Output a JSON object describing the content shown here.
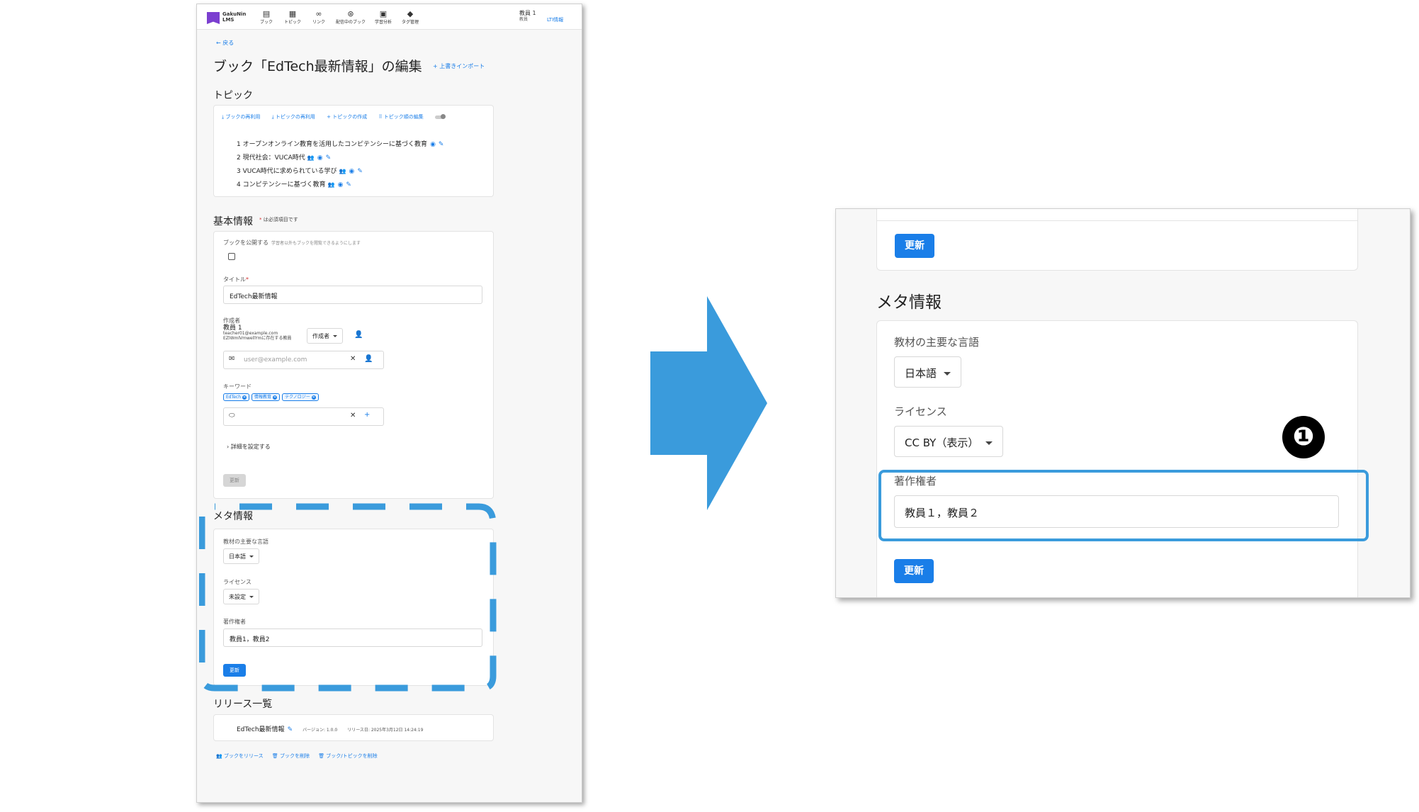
{
  "nav": {
    "logo_line1": "GakuNin",
    "logo_line2": "LMS",
    "items": [
      {
        "icon": "▤",
        "label": "ブック"
      },
      {
        "icon": "▦",
        "label": "トピック"
      },
      {
        "icon": "∞",
        "label": "リンク"
      },
      {
        "icon": "⊛",
        "label": "配信中のブック"
      },
      {
        "icon": "▣",
        "label": "学習分析"
      },
      {
        "icon": "◆",
        "label": "タグ管理"
      }
    ],
    "user_name": "教員 1",
    "user_role": "教員",
    "lti_link": "LTI情報"
  },
  "page": {
    "back_label": "← 戻る",
    "title": "ブック「EdTech最新情報」の編集",
    "import_label": "+ 上書きインポート"
  },
  "topics": {
    "heading": "トピック",
    "toolbar": [
      "⤓ ブックの再利用",
      "⤓ トピックの再利用",
      "+ トピックの作成",
      "⠿ トピック順の編集"
    ],
    "rows": [
      {
        "text": "1 オープンオンライン教育を活用したコンピテンシーに基づく教育",
        "icon": "◉"
      },
      {
        "text": "2 現代社会：VUCA時代",
        "icon": "◉"
      },
      {
        "text": "3 VUCA時代に求められている学び",
        "icon": "◉"
      },
      {
        "text": "4 コンピテンシーに基づく教育",
        "icon": "◉"
      }
    ],
    "group_icon": "👥",
    "edit_icon": "✎"
  },
  "basic": {
    "heading": "基本情報",
    "req_star": "*",
    "req_note": "は必須項目です",
    "publish_label": "ブックを公開する",
    "publish_sub": "学習者以外もブックを閲覧できるようにします",
    "title_label": "タイトル",
    "title_star": "*",
    "title_value": "EdTech最新情報",
    "author_label": "作成者",
    "author_name": "教員 1",
    "author_email": "teacher01@example.com",
    "author_note": "EZlWmlVmwellYmに存在する教員",
    "author_role": "作成者",
    "email_placeholder": "user@example.com",
    "keyword_label": "キーワード",
    "keywords": [
      "EdTech",
      "情報教育",
      "テクノロジー"
    ],
    "detail_label": "詳細を設定する",
    "update_label": "更新"
  },
  "meta_small": {
    "heading": "メタ情報",
    "language_label": "教材の主要な言語",
    "language_value": "日本語",
    "license_label": "ライセンス",
    "license_value": "未設定",
    "copyright_label": "著作権者",
    "copyright_value": "教員1，教員2",
    "update_label": "更新"
  },
  "releases": {
    "heading": "リリース一覧",
    "name": "EdTech最新情報",
    "version": "バージョン: 1.0.0",
    "date": "リリース日: 2025年3月12日 14:24:19"
  },
  "bottom_links": [
    "👥 ブックをリリース",
    "🗑 ブックを削除",
    "🗑 ブック/トピックを削除"
  ],
  "zoom": {
    "update_label_top": "更新",
    "heading": "メタ情報",
    "language_label": "教材の主要な言語",
    "language_value": "日本語",
    "license_label": "ライセンス",
    "license_value": "CC BY（表示）",
    "copyright_label": "著作権者",
    "copyright_value": "教員１，教員２",
    "update_label": "更新",
    "badge": "❶"
  },
  "colors": {
    "primary": "#1a7ee8",
    "highlight": "#3a9bdc",
    "arrow": "#3a9bdc"
  }
}
